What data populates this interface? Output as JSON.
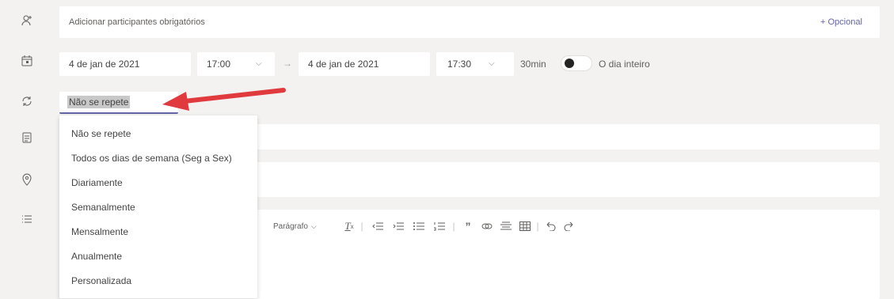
{
  "participants": {
    "placeholder": "Adicionar participantes obrigatórios",
    "optional_link": "+ Opcional"
  },
  "datetime": {
    "start_date": "4 de jan de 2021",
    "start_time": "17:00",
    "arrow": "→",
    "end_date": "4 de jan de 2021",
    "end_time": "17:30",
    "duration": "30min",
    "all_day_label": "O dia inteiro",
    "all_day_on": false
  },
  "repeat": {
    "selected": "Não se repete",
    "options": [
      "Não se repete",
      "Todos os dias de semana (Seg a Sex)",
      "Diariamente",
      "Semanalmente",
      "Mensalmente",
      "Anualmente",
      "Personalizada"
    ]
  },
  "editor": {
    "format_label": "Parágrafo",
    "toolbar_icons": [
      "clear-format-icon",
      "decrease-indent-icon",
      "increase-indent-icon",
      "bullet-list-icon",
      "numbered-list-icon",
      "quote-icon",
      "link-icon",
      "align-icon",
      "table-icon",
      "undo-icon",
      "redo-icon"
    ]
  },
  "colors": {
    "accent": "#6264a7",
    "annotation_arrow": "#e03a3e"
  }
}
